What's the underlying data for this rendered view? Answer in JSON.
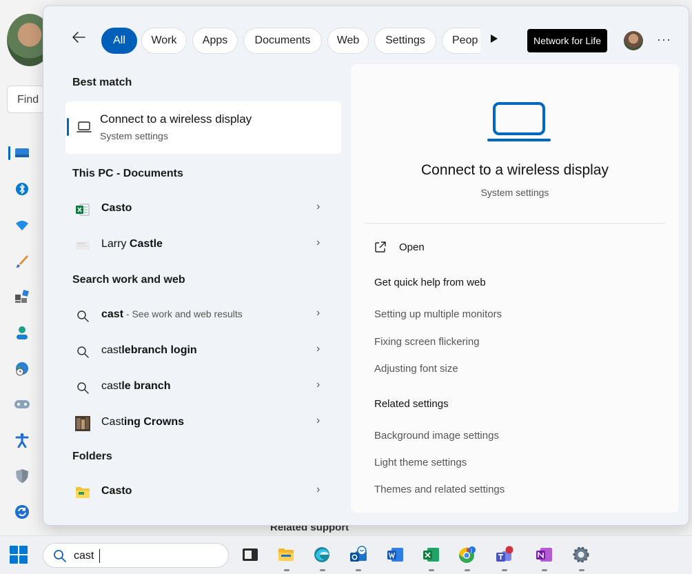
{
  "background": {
    "find_placeholder": "Find",
    "related_support": "Related support",
    "nav_icons": [
      "display-icon",
      "bluetooth-icon",
      "wifi-icon",
      "brush-icon",
      "apps-icon",
      "account-icon",
      "time-language-icon",
      "gaming-icon",
      "accessibility-icon",
      "privacy-shield-icon",
      "windows-update-icon"
    ]
  },
  "flyout": {
    "filters": [
      "All",
      "Work",
      "Apps",
      "Documents",
      "Web",
      "Settings",
      "Peop"
    ],
    "active_filter": "All",
    "org_badge": "Network for Life",
    "more_label": "···",
    "left": {
      "best_match_heading": "Best match",
      "best_match": {
        "title": "Connect to a wireless display",
        "subtitle": "System settings"
      },
      "this_pc_heading": "This PC - Documents",
      "this_pc_items": [
        {
          "pre": "",
          "bold": "Casto",
          "post": ""
        },
        {
          "pre": "Larry ",
          "bold": "Castle",
          "post": ""
        }
      ],
      "web_heading": "Search work and web",
      "web_items": [
        {
          "pre": "",
          "bold": "cast",
          "sub": " - See work and web results"
        },
        {
          "pre": "cast",
          "bold": "lebranch login",
          "sub": ""
        },
        {
          "pre": "cast",
          "bold": "le branch",
          "sub": ""
        },
        {
          "pre": "Cast",
          "bold": "ing Crowns",
          "sub": ""
        }
      ],
      "folders_heading": "Folders",
      "folder_items": [
        {
          "pre": "",
          "bold": "Casto",
          "post": ""
        }
      ]
    },
    "right": {
      "title": "Connect to a wireless display",
      "subtitle": "System settings",
      "open_label": "Open",
      "quick_help_heading": "Get quick help from web",
      "quick_help_links": [
        "Setting up multiple monitors",
        "Fixing screen flickering",
        "Adjusting font size"
      ],
      "related_heading": "Related settings",
      "related_links": [
        "Background image settings",
        "Light theme settings",
        "Themes and related settings"
      ]
    }
  },
  "taskbar": {
    "search_value": "cast",
    "apps": [
      "terminal-icon",
      "file-explorer-icon",
      "edge-icon",
      "outlook-icon",
      "word-icon",
      "excel-icon",
      "chrome-icon",
      "teams-icon",
      "onenote-icon",
      "settings-icon"
    ]
  },
  "colors": {
    "accent": "#005fb8",
    "accent_blue": "#0067c0"
  }
}
